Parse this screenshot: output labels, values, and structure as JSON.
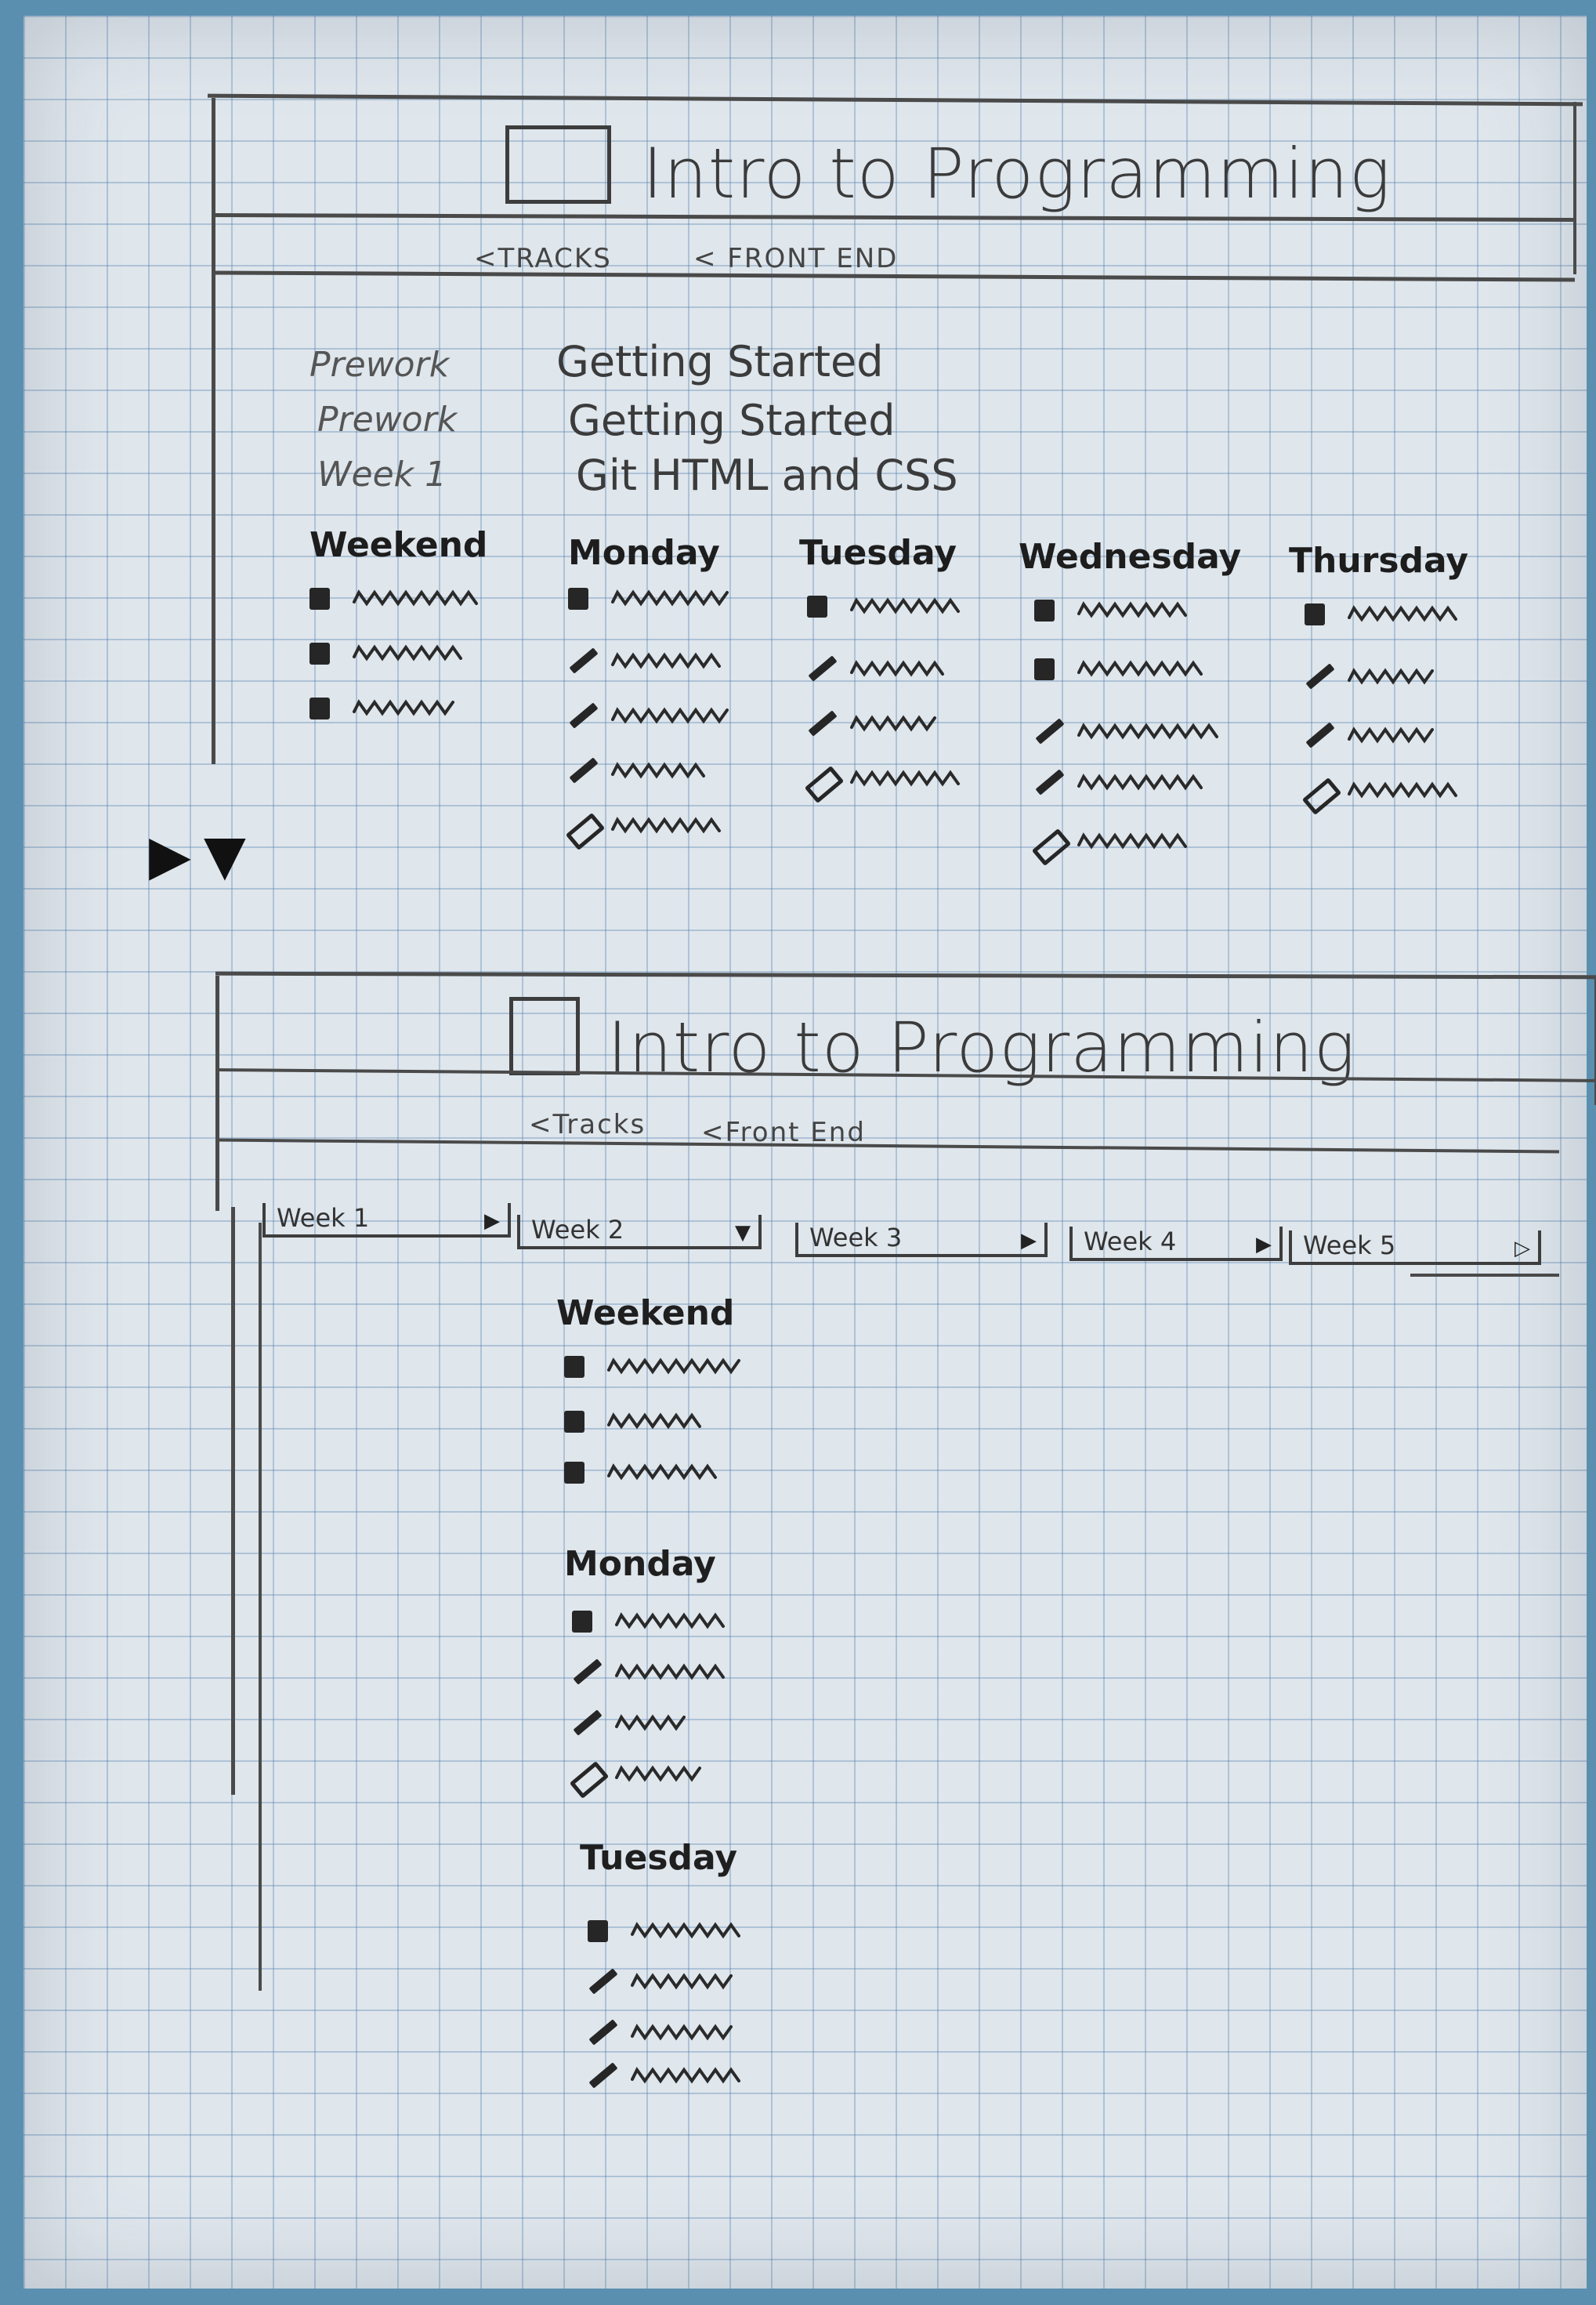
{
  "wireframe1": {
    "title": "Intro to Programming",
    "breadcrumb": [
      "<TRACKS",
      "< FRONT END"
    ],
    "rows": [
      {
        "label": "Prework",
        "value": "Getting Started"
      },
      {
        "label": "Prework",
        "value": "Getting Started"
      },
      {
        "label": "Week 1",
        "value": "Git HTML and CSS"
      }
    ],
    "days": [
      "Weekend",
      "Monday",
      "Tuesday",
      "Wednesday",
      "Thursday"
    ]
  },
  "wireframe2": {
    "title": "Intro to Programming",
    "breadcrumb": [
      "<Tracks",
      "<Front End"
    ],
    "tabs": [
      "Week 1",
      "Week 2",
      "Week 3",
      "Week 4",
      "Week 5"
    ],
    "days": [
      "Weekend",
      "Monday",
      "Tuesday"
    ]
  }
}
